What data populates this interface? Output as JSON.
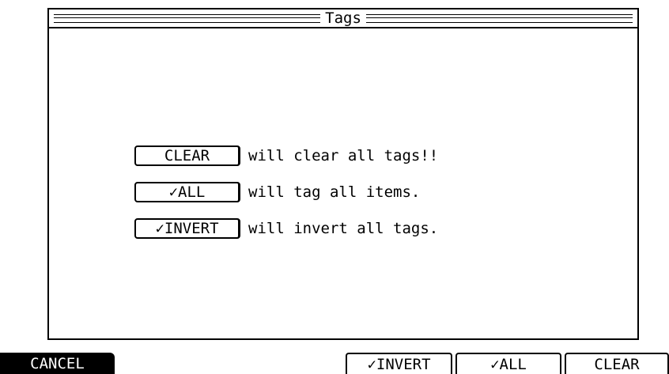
{
  "dialog": {
    "title": "Tags",
    "help_rows": [
      {
        "button_label": "CLEAR",
        "description": "will clear all tags!!"
      },
      {
        "button_label": "✓ALL",
        "description": "will tag all items."
      },
      {
        "button_label": "✓INVERT",
        "description": "will invert all tags."
      }
    ]
  },
  "softkeys": {
    "cancel": "CANCEL",
    "invert": "✓INVERT",
    "all": "✓ALL",
    "clear": "CLEAR"
  },
  "colors": {
    "foreground": "#000000",
    "background": "#ffffff"
  }
}
